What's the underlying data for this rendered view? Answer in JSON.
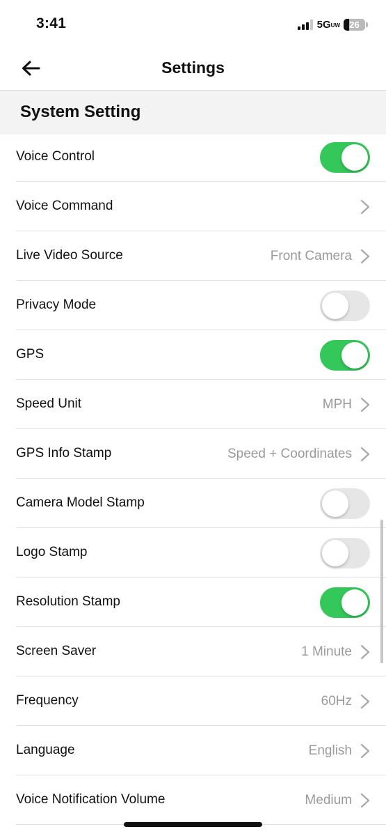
{
  "status_bar": {
    "time": "3:41",
    "network": "5G",
    "network_suffix": "UW",
    "battery": "26",
    "signal_icon": "signal-bars-icon",
    "battery_icon": "battery-icon"
  },
  "header": {
    "title": "Settings",
    "back_icon": "arrow-left-icon"
  },
  "section": {
    "title": "System Setting"
  },
  "items": [
    {
      "label": "Voice Control",
      "type": "toggle",
      "on": true
    },
    {
      "label": "Voice Command",
      "type": "nav",
      "value": ""
    },
    {
      "label": "Live Video Source",
      "type": "nav",
      "value": "Front Camera"
    },
    {
      "label": "Privacy Mode",
      "type": "toggle",
      "on": false
    },
    {
      "label": "GPS",
      "type": "toggle",
      "on": true
    },
    {
      "label": "Speed Unit",
      "type": "nav",
      "value": "MPH"
    },
    {
      "label": "GPS Info Stamp",
      "type": "nav",
      "value": "Speed + Coordinates"
    },
    {
      "label": "Camera Model Stamp",
      "type": "toggle",
      "on": false
    },
    {
      "label": "Logo Stamp",
      "type": "toggle",
      "on": false
    },
    {
      "label": "Resolution Stamp",
      "type": "toggle",
      "on": true
    },
    {
      "label": "Screen Saver",
      "type": "nav",
      "value": "1 Minute"
    },
    {
      "label": "Frequency",
      "type": "nav",
      "value": "60Hz"
    },
    {
      "label": "Language",
      "type": "nav",
      "value": "English"
    },
    {
      "label": "Voice Notification Volume",
      "type": "nav",
      "value": "Medium"
    }
  ],
  "colors": {
    "toggle_on": "#34c759",
    "toggle_off": "#e6e6e6",
    "value_text": "#9a9a9a",
    "section_bg": "#f3f3f3"
  }
}
